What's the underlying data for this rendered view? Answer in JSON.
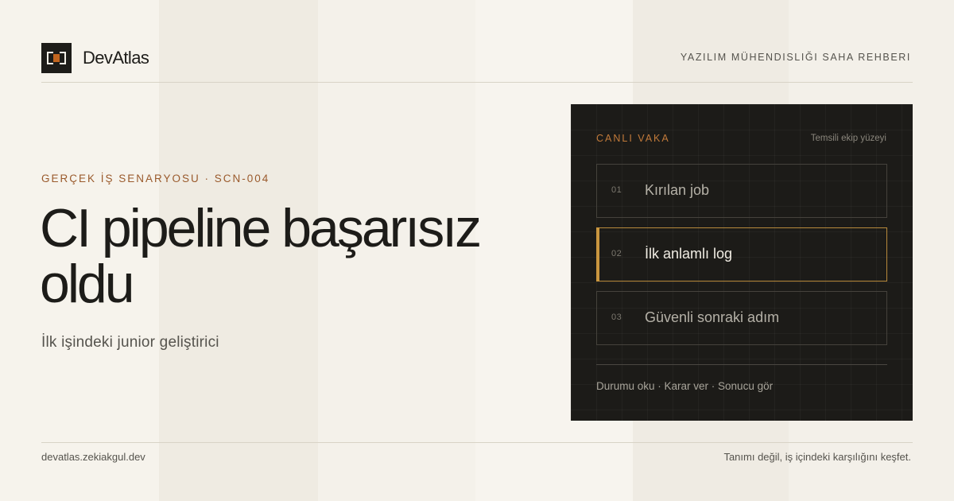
{
  "brand": {
    "name": "DevAtlas",
    "logo_icon": "bracket-logo-icon",
    "accent_color": "#c2651f"
  },
  "header": {
    "tagline": "YAZILIM MÜHENDISLIĞI SAHA REHBERI"
  },
  "hero": {
    "eyebrow": "GERÇEK İŞ SENARYOSU · SCN-004",
    "title": "CI pipeline başarısız oldu",
    "subtitle": "İlk işindeki junior geliştirici"
  },
  "case_card": {
    "label": "CANLI VAKA",
    "note": "Temsili ekip yüzeyi",
    "steps": [
      {
        "num": "01",
        "label": "Kırılan job",
        "active": false
      },
      {
        "num": "02",
        "label": "İlk anlamlı log",
        "active": true
      },
      {
        "num": "03",
        "label": "Güvenli sonraki adım",
        "active": false
      }
    ],
    "footer": "Durumu oku · Karar ver · Sonucu gör"
  },
  "footer": {
    "url": "devatlas.zekiakgul.dev",
    "slogan": "Tanımı değil, iş içindeki karşılığını keşfet."
  },
  "colors": {
    "dark_card": "#1c1b18",
    "active_border": "#b88a3c",
    "eyebrow": "#9a5a2c"
  }
}
